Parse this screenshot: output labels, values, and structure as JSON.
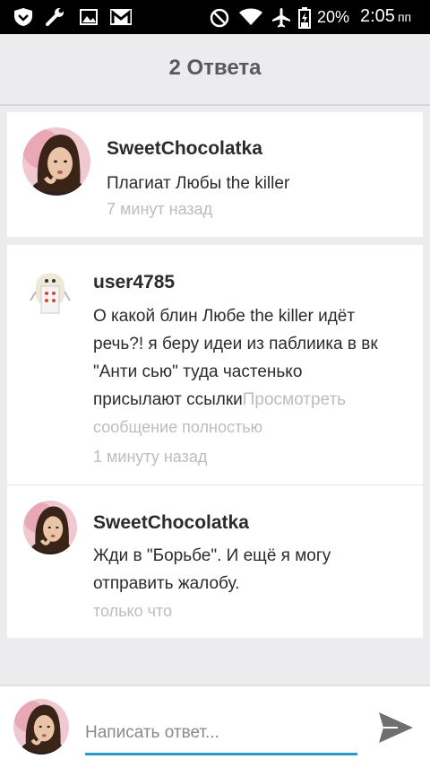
{
  "status_bar": {
    "battery": "20%",
    "time": "2:05",
    "ampm": "пп",
    "icons": [
      "shield-icon",
      "wrench-icon",
      "image-icon",
      "gmail-icon",
      "no-disturb-icon",
      "wifi-icon",
      "airplane-icon",
      "battery-icon"
    ]
  },
  "header": {
    "title": "2 Ответа"
  },
  "comments": [
    {
      "author": "SweetChocolatka",
      "text": "Плагиат Любы the killer",
      "time": "7 минут назад"
    },
    {
      "author": "user4785",
      "text_lines": [
        "О какой блин Любе  the killer идёт",
        "речь?! я беру идеи из паблиика в вк",
        "\"Анти сью\" туда частенько",
        "присылают ссылки"
      ],
      "more_inline": "Просмотреть",
      "more_cont": "сообщение полностью",
      "time": "1 минуту назад"
    },
    {
      "author": "SweetChocolatka",
      "text_lines": [
        "Жди в \"Борьбе\". И ещё я могу",
        "отправить жалобу."
      ],
      "time": "только что"
    }
  ],
  "composer": {
    "placeholder": "Написать ответ..."
  },
  "colors": {
    "accent": "#2a9bc9",
    "background": "#ecebee",
    "muted": "#bdbdbd"
  }
}
